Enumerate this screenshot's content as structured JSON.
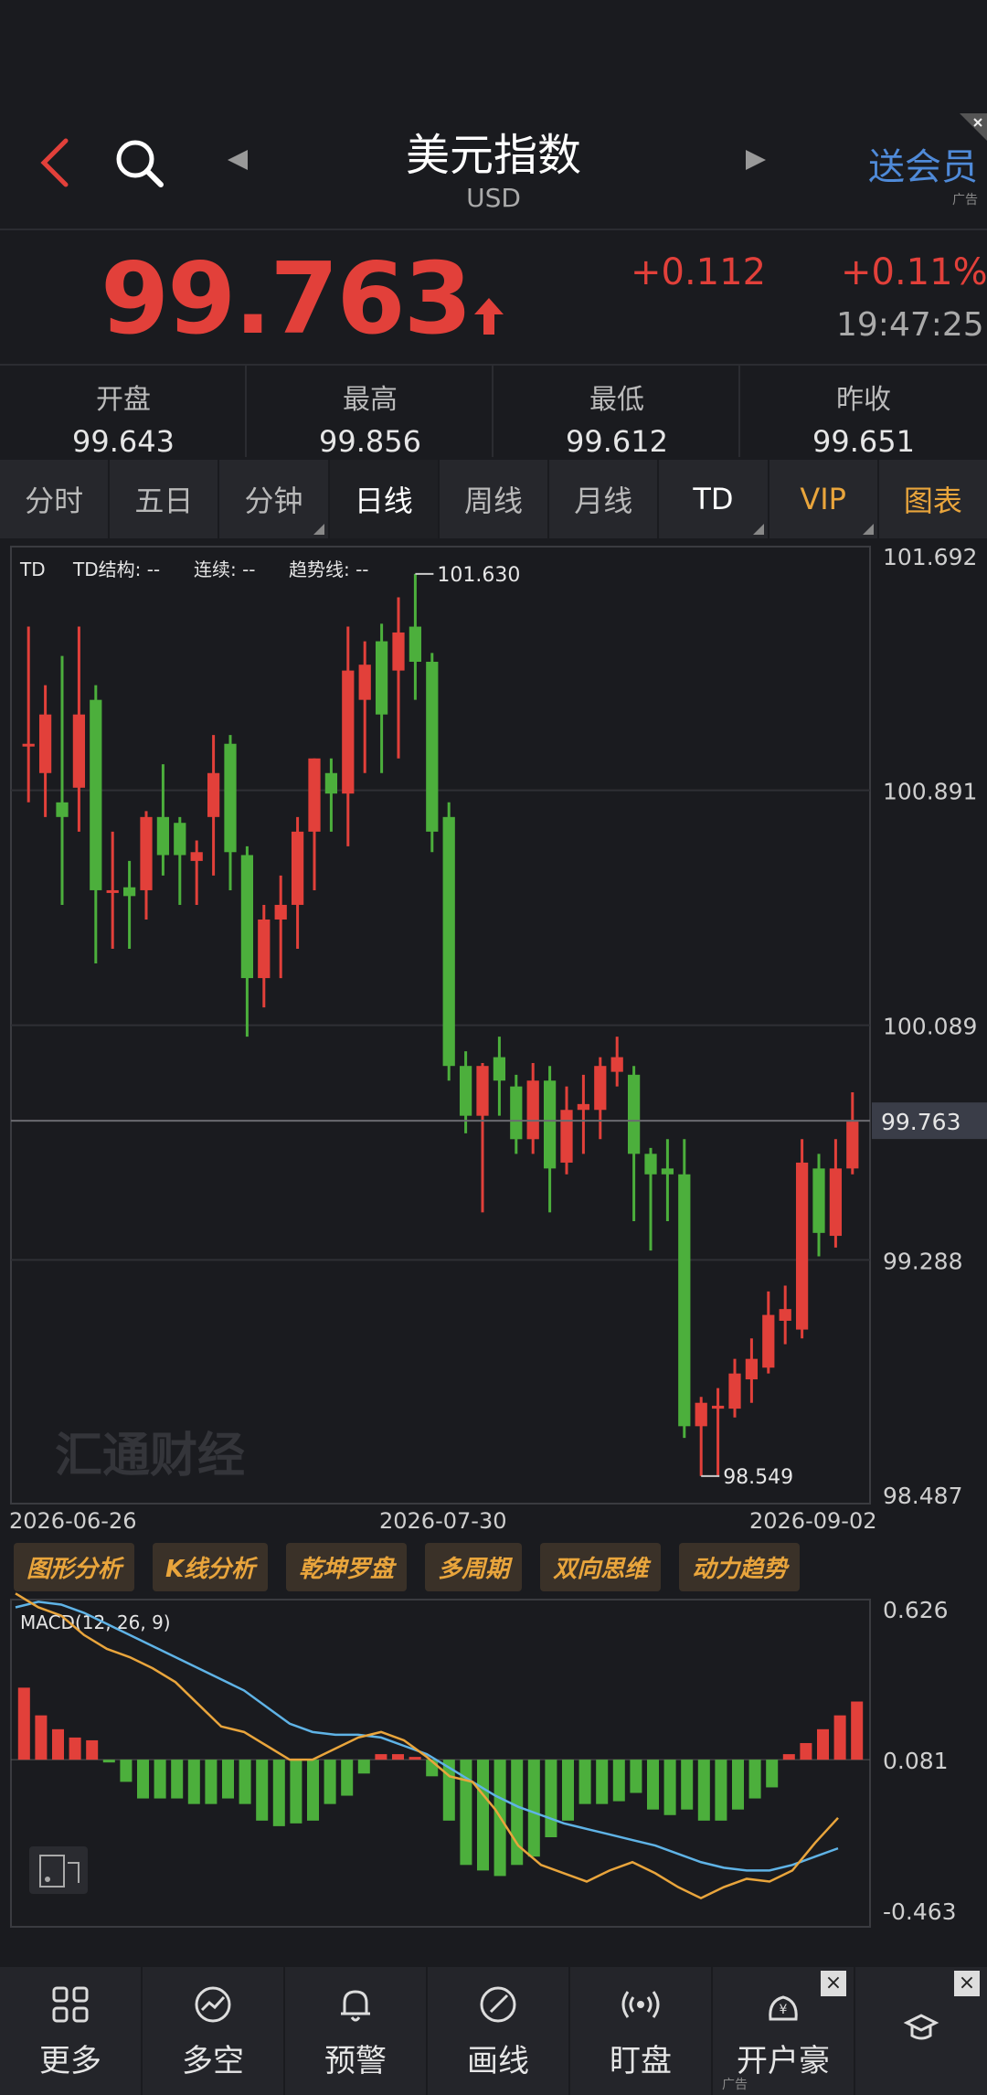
{
  "header": {
    "title": "美元指数",
    "subtitle": "USD",
    "vip_ad": "送会员",
    "ad_label": "广告"
  },
  "quote": {
    "price": "99.763",
    "change": "+0.112",
    "change_pct": "+0.11%",
    "time": "19:47:25"
  },
  "stats": [
    {
      "label": "开盘",
      "value": "99.643"
    },
    {
      "label": "最高",
      "value": "99.856"
    },
    {
      "label": "最低",
      "value": "99.612"
    },
    {
      "label": "昨收",
      "value": "99.651"
    }
  ],
  "tabs": [
    {
      "label": "分时",
      "active": false
    },
    {
      "label": "五日",
      "active": false
    },
    {
      "label": "分钟",
      "active": false,
      "has_menu": true
    },
    {
      "label": "日线",
      "active": true
    },
    {
      "label": "周线",
      "active": false
    },
    {
      "label": "月线",
      "active": false
    },
    {
      "label": "TD",
      "active": false,
      "has_menu": true
    },
    {
      "label": "VIP",
      "active": false,
      "has_menu": true
    },
    {
      "label": "图表",
      "active": false
    }
  ],
  "chart_legend": {
    "td": "TD",
    "td_structure": "TD结构: --",
    "continuous": "连续: --",
    "trendline": "趋势线: --"
  },
  "chart_data": {
    "type": "candlestick",
    "ylim": [
      98.487,
      101.692
    ],
    "y_ticks": [
      "101.692",
      "100.891",
      "100.089",
      "99.288",
      "98.487"
    ],
    "current_price_label": "99.763",
    "high_annotation": "101.630",
    "low_annotation": "98.549",
    "x_ticks": [
      "2026-06-26",
      "2026-07-30",
      "2026-09-02"
    ],
    "candles": [
      {
        "o": 101.05,
        "c": 101.05,
        "h": 101.45,
        "l": 100.85
      },
      {
        "o": 100.95,
        "c": 101.15,
        "h": 101.25,
        "l": 100.8
      },
      {
        "o": 100.85,
        "c": 100.8,
        "h": 101.35,
        "l": 100.5
      },
      {
        "o": 100.9,
        "c": 101.15,
        "h": 101.45,
        "l": 100.75
      },
      {
        "o": 101.2,
        "c": 100.55,
        "h": 101.25,
        "l": 100.3
      },
      {
        "o": 100.55,
        "c": 100.55,
        "h": 100.75,
        "l": 100.35
      },
      {
        "o": 100.56,
        "c": 100.53,
        "h": 100.65,
        "l": 100.35
      },
      {
        "o": 100.55,
        "c": 100.8,
        "h": 100.82,
        "l": 100.45
      },
      {
        "o": 100.8,
        "c": 100.67,
        "h": 100.98,
        "l": 100.6
      },
      {
        "o": 100.78,
        "c": 100.67,
        "h": 100.8,
        "l": 100.5
      },
      {
        "o": 100.65,
        "c": 100.68,
        "h": 100.72,
        "l": 100.5
      },
      {
        "o": 100.8,
        "c": 100.95,
        "h": 101.08,
        "l": 100.6
      },
      {
        "o": 101.05,
        "c": 100.68,
        "h": 101.08,
        "l": 100.55
      },
      {
        "o": 100.67,
        "c": 100.25,
        "h": 100.7,
        "l": 100.05
      },
      {
        "o": 100.25,
        "c": 100.45,
        "h": 100.5,
        "l": 100.15
      },
      {
        "o": 100.45,
        "c": 100.5,
        "h": 100.6,
        "l": 100.25
      },
      {
        "o": 100.5,
        "c": 100.75,
        "h": 100.8,
        "l": 100.35
      },
      {
        "o": 100.75,
        "c": 101.0,
        "h": 101.0,
        "l": 100.55
      },
      {
        "o": 100.95,
        "c": 100.88,
        "h": 101.0,
        "l": 100.75
      },
      {
        "o": 100.88,
        "c": 101.3,
        "h": 101.45,
        "l": 100.7
      },
      {
        "o": 101.2,
        "c": 101.32,
        "h": 101.4,
        "l": 100.95
      },
      {
        "o": 101.4,
        "c": 101.15,
        "h": 101.46,
        "l": 100.95
      },
      {
        "o": 101.3,
        "c": 101.43,
        "h": 101.55,
        "l": 101.0
      },
      {
        "o": 101.45,
        "c": 101.33,
        "h": 101.63,
        "l": 101.2
      },
      {
        "o": 101.33,
        "c": 100.75,
        "h": 101.36,
        "l": 100.68
      },
      {
        "o": 100.8,
        "c": 99.95,
        "h": 100.85,
        "l": 99.9
      },
      {
        "o": 99.95,
        "c": 99.78,
        "h": 100.0,
        "l": 99.72
      },
      {
        "o": 99.78,
        "c": 99.95,
        "h": 99.96,
        "l": 99.45
      },
      {
        "o": 99.98,
        "c": 99.9,
        "h": 100.05,
        "l": 99.78
      },
      {
        "o": 99.88,
        "c": 99.7,
        "h": 99.92,
        "l": 99.65
      },
      {
        "o": 99.7,
        "c": 99.9,
        "h": 99.96,
        "l": 99.65
      },
      {
        "o": 99.9,
        "c": 99.6,
        "h": 99.95,
        "l": 99.45
      },
      {
        "o": 99.62,
        "c": 99.8,
        "h": 99.88,
        "l": 99.58
      },
      {
        "o": 99.8,
        "c": 99.82,
        "h": 99.92,
        "l": 99.65
      },
      {
        "o": 99.8,
        "c": 99.95,
        "h": 99.98,
        "l": 99.7
      },
      {
        "o": 99.93,
        "c": 99.98,
        "h": 100.05,
        "l": 99.88
      },
      {
        "o": 99.92,
        "c": 99.65,
        "h": 99.95,
        "l": 99.42
      },
      {
        "o": 99.65,
        "c": 99.58,
        "h": 99.67,
        "l": 99.32
      },
      {
        "o": 99.6,
        "c": 99.58,
        "h": 99.7,
        "l": 99.42
      },
      {
        "o": 99.58,
        "c": 98.72,
        "h": 99.7,
        "l": 98.68
      },
      {
        "o": 98.72,
        "c": 98.8,
        "h": 98.82,
        "l": 98.55
      },
      {
        "o": 98.78,
        "c": 98.79,
        "h": 98.85,
        "l": 98.55
      },
      {
        "o": 98.78,
        "c": 98.9,
        "h": 98.95,
        "l": 98.75
      },
      {
        "o": 98.88,
        "c": 98.95,
        "h": 99.02,
        "l": 98.8
      },
      {
        "o": 98.92,
        "c": 99.1,
        "h": 99.18,
        "l": 98.9
      },
      {
        "o": 99.08,
        "c": 99.12,
        "h": 99.2,
        "l": 99.0
      },
      {
        "o": 99.05,
        "c": 99.62,
        "h": 99.7,
        "l": 99.02
      },
      {
        "o": 99.6,
        "c": 99.38,
        "h": 99.65,
        "l": 99.3
      },
      {
        "o": 99.37,
        "c": 99.6,
        "h": 99.7,
        "l": 99.33
      },
      {
        "o": 99.6,
        "c": 99.76,
        "h": 99.86,
        "l": 99.58
      }
    ],
    "macd": {
      "label": "MACD(12, 26, 9)",
      "ylim": [
        -0.463,
        0.626
      ],
      "y_ticks": [
        "0.626",
        "0.081",
        "-0.463"
      ],
      "hist": [
        0.26,
        0.16,
        0.11,
        0.08,
        0.07,
        -0.01,
        -0.08,
        -0.14,
        -0.14,
        -0.14,
        -0.16,
        -0.16,
        -0.14,
        -0.16,
        -0.22,
        -0.24,
        -0.23,
        -0.22,
        -0.16,
        -0.13,
        -0.05,
        0.02,
        0.02,
        0.01,
        -0.06,
        -0.22,
        -0.38,
        -0.4,
        -0.42,
        -0.38,
        -0.35,
        -0.28,
        -0.22,
        -0.16,
        -0.16,
        -0.15,
        -0.12,
        -0.18,
        -0.2,
        -0.18,
        -0.22,
        -0.22,
        -0.18,
        -0.14,
        -0.1,
        0.02,
        0.06,
        0.11,
        0.16,
        0.21
      ],
      "dif": [
        0.6,
        0.55,
        0.52,
        0.45,
        0.4,
        0.37,
        0.33,
        0.28,
        0.2,
        0.12,
        0.1,
        0.05,
        0.0,
        0.0,
        0.04,
        0.08,
        0.1,
        0.07,
        0.01,
        -0.06,
        -0.08,
        -0.18,
        -0.31,
        -0.38,
        -0.41,
        -0.44,
        -0.4,
        -0.37,
        -0.41,
        -0.46,
        -0.5,
        -0.46,
        -0.43,
        -0.44,
        -0.4,
        -0.3,
        -0.21
      ],
      "dea": [
        0.55,
        0.57,
        0.56,
        0.53,
        0.49,
        0.45,
        0.41,
        0.37,
        0.33,
        0.29,
        0.25,
        0.19,
        0.13,
        0.1,
        0.09,
        0.09,
        0.08,
        0.05,
        0.02,
        -0.03,
        -0.08,
        -0.13,
        -0.17,
        -0.2,
        -0.23,
        -0.25,
        -0.27,
        -0.29,
        -0.31,
        -0.34,
        -0.37,
        -0.39,
        -0.4,
        -0.4,
        -0.38,
        -0.35,
        -0.32
      ]
    }
  },
  "tools": [
    "图形分析",
    "K线分析",
    "乾坤罗盘",
    "多周期",
    "双向思维",
    "动力趋势"
  ],
  "bottom_nav": [
    {
      "label": "更多",
      "icon": "grid-icon"
    },
    {
      "label": "多空",
      "icon": "trend-icon"
    },
    {
      "label": "预警",
      "icon": "bell-icon"
    },
    {
      "label": "画线",
      "icon": "pen-icon"
    },
    {
      "label": "盯盘",
      "icon": "signal-icon"
    },
    {
      "label": "开户豪",
      "icon": "bag-icon"
    },
    {
      "label": "",
      "icon": "cap-icon"
    }
  ],
  "bottom_ad_label": "广告",
  "watermark": "汇通财经",
  "colors": {
    "up": "#e2403a",
    "down": "#4caf3c",
    "dif": "#5fb3e6",
    "dea": "#e9a53c",
    "accent": "#e9a53c"
  }
}
